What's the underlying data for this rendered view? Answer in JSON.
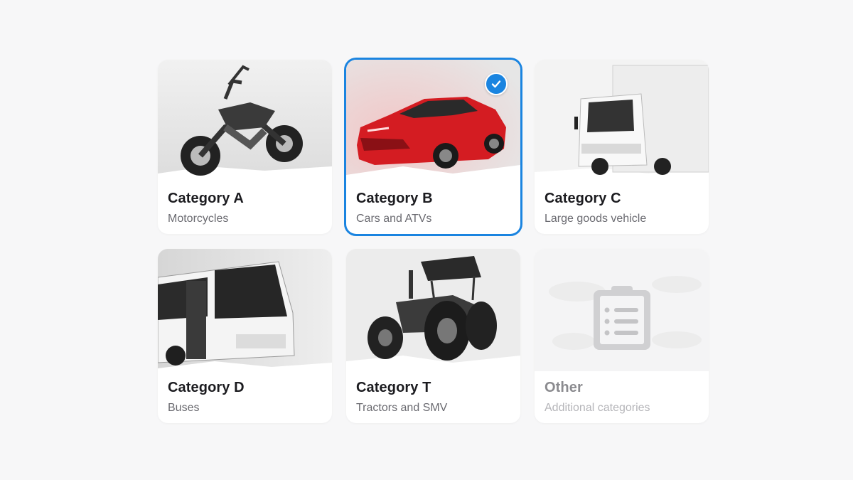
{
  "categories": [
    {
      "title": "Category A",
      "subtitle": "Motorcycles",
      "icon": "motorcycle-image",
      "selected": false
    },
    {
      "title": "Category B",
      "subtitle": "Cars and ATVs",
      "icon": "car-image",
      "selected": true
    },
    {
      "title": "Category C",
      "subtitle": "Large goods vehicle",
      "icon": "truck-image",
      "selected": false
    },
    {
      "title": "Category D",
      "subtitle": "Buses",
      "icon": "bus-image",
      "selected": false
    },
    {
      "title": "Category T",
      "subtitle": "Tractors and SMV",
      "icon": "tractor-image",
      "selected": false
    },
    {
      "title": "Other",
      "subtitle": "Additional categories",
      "icon": "clipboard-list-icon",
      "selected": false
    }
  ],
  "colors": {
    "accent": "#1a84e0",
    "background": "#f7f7f8",
    "card": "#ffffff"
  }
}
